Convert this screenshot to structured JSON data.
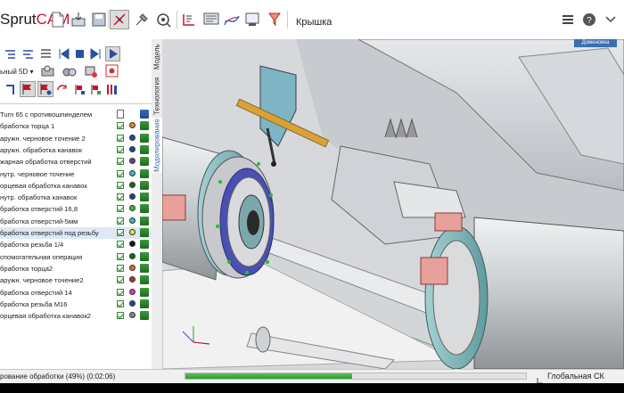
{
  "app": {
    "logo_a": "Sprut",
    "logo_b": "CAM",
    "document_title": "Крышка"
  },
  "toolbar": {
    "icons": [
      "new-file-icon",
      "import-icon",
      "save-icon",
      "machine-icon",
      "tool-icon",
      "measure-icon",
      "grid-icon",
      "report-icon",
      "chart-icon",
      "nc-export-icon",
      "filter-icon"
    ]
  },
  "right_icons": [
    "menu-icon",
    "help-icon",
    "dropdown-icon"
  ],
  "view_label": "Доменовка",
  "left_panel": {
    "machine_selector": "ьный 5D",
    "vtabs": {
      "model": "Модель",
      "technology": "Технология",
      "simulation": "Моделирование"
    },
    "root_item": "Turn 65 с противошпинделем",
    "operations": [
      {
        "name": "бработка торца 1",
        "dot": "#e08a1e",
        "mach": "green"
      },
      {
        "name": "аружн. черновое точение 2",
        "dot": "#2a3fa8",
        "mach": "green"
      },
      {
        "name": "аружн. обработка канавок",
        "dot": "#2a3fa8",
        "mach": "green"
      },
      {
        "name": "жарная обработка отверстий",
        "dot": "#6a3b9a",
        "mach": "green"
      },
      {
        "name": "нутр. черновое точение",
        "dot": "#3fb9c9",
        "mach": "green"
      },
      {
        "name": "орцевая обработка канавок",
        "dot": "#1a6a1a",
        "mach": "green"
      },
      {
        "name": "нутр. обработка канавок",
        "dot": "#2a3fa8",
        "mach": "green"
      },
      {
        "name": "бработка отверстий 16,8",
        "dot": "#3ab83a",
        "mach": "green"
      },
      {
        "name": "бработка отверстий-5мм",
        "dot": "#3ab8c0",
        "mach": "green"
      },
      {
        "name": "бработка отверстий под резьбу",
        "dot": "#e8e83a",
        "mach": "green"
      },
      {
        "name": "бработка резьба 1/4",
        "dot": "#111111",
        "mach": "green"
      },
      {
        "name": "спомогательная операция",
        "dot": "#1a6a1a",
        "mach": "green"
      },
      {
        "name": "бработка торца2",
        "dot": "#e0701e",
        "mach": "green"
      },
      {
        "name": "аружн. черновое точение2",
        "dot": "#a83a2a",
        "mach": "green"
      },
      {
        "name": "бработка отверстий 14",
        "dot": "#d63ac0",
        "mach": "green"
      },
      {
        "name": "бработка резьба М16",
        "dot": "#2a3fa8",
        "mach": "green"
      },
      {
        "name": "орцевая обработка канавок2",
        "dot": "#888888",
        "mach": "green"
      }
    ]
  },
  "status": {
    "text": "рование обработки (49%) (0:02:06)",
    "progress": 0.49,
    "coord_system": "Глобальная СК"
  }
}
